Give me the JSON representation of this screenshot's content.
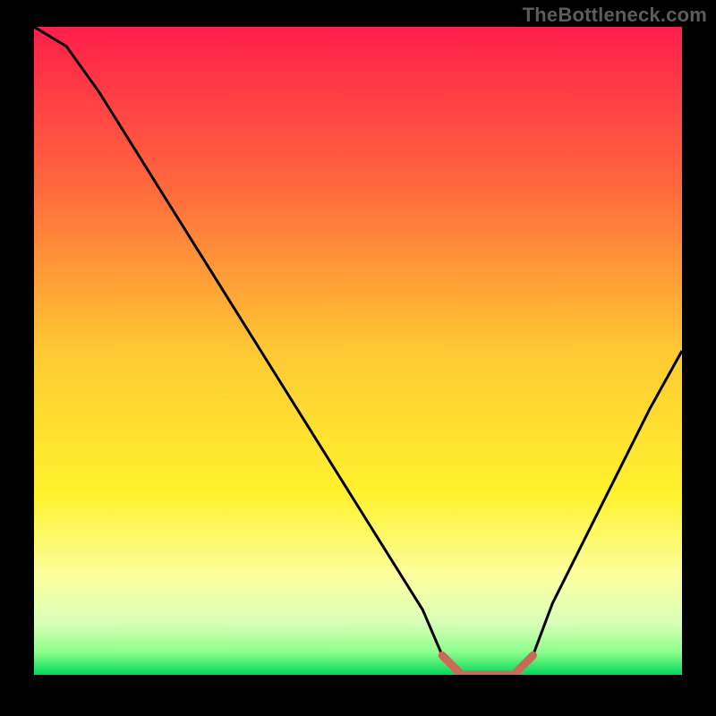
{
  "watermark": "TheBottleneck.com",
  "chart_data": {
    "type": "line",
    "title": "",
    "xlabel": "",
    "ylabel": "",
    "xlim": [
      0,
      100
    ],
    "ylim": [
      0,
      100
    ],
    "grid": false,
    "series": [
      {
        "name": "bottleneck-curve",
        "x": [
          0,
          5,
          10,
          15,
          20,
          25,
          30,
          35,
          40,
          45,
          50,
          55,
          60,
          63,
          66,
          70,
          74,
          77,
          80,
          85,
          90,
          95,
          100
        ],
        "values": [
          100,
          97,
          90,
          82,
          74,
          66,
          58,
          50,
          42,
          34,
          26,
          18,
          10,
          3,
          0,
          0,
          0,
          3,
          11,
          21,
          31,
          41,
          50
        ]
      }
    ],
    "highlight": {
      "name": "flat-valley",
      "color": "#cc6a5a",
      "x": [
        63,
        66,
        70,
        74,
        77
      ],
      "values": [
        3,
        0,
        0,
        0,
        3
      ]
    },
    "gradient_stops": [
      {
        "offset": 0.0,
        "color": "#ff1e4b"
      },
      {
        "offset": 0.25,
        "color": "#ff6a3c"
      },
      {
        "offset": 0.5,
        "color": "#ffc933"
      },
      {
        "offset": 0.72,
        "color": "#fff22e"
      },
      {
        "offset": 0.85,
        "color": "#fcffa0"
      },
      {
        "offset": 0.92,
        "color": "#d8ffb8"
      },
      {
        "offset": 0.965,
        "color": "#8cff8c"
      },
      {
        "offset": 1.0,
        "color": "#00d85a"
      }
    ]
  }
}
